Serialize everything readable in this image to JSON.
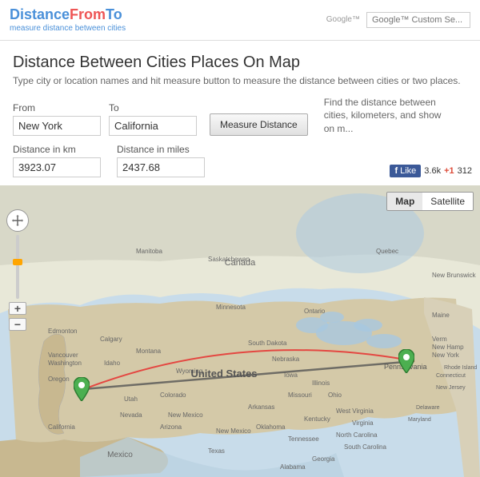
{
  "header": {
    "logo": "DistanceFromTo",
    "logo_distance": "Distance",
    "logo_from": "From",
    "logo_to": "To",
    "subtitle": "measure distance between cities",
    "search_placeholder": "Google™ Custom Se..."
  },
  "page": {
    "title": "Distance Between Cities Places On Map",
    "subtitle": "Type city or location names and hit measure button to measure the distance between cities or two places."
  },
  "form": {
    "from_label": "From",
    "from_value": "New York",
    "to_label": "To",
    "to_value": "California",
    "measure_button": "Measure Distance",
    "right_info": "Find the distance between cities, kilometers, and show on m..."
  },
  "distances": {
    "km_label": "Distance in km",
    "km_value": "3923.07",
    "miles_label": "Distance in miles",
    "miles_value": "2437.68"
  },
  "social": {
    "like_label": "Like",
    "like_count": "3.6k",
    "gplus_label": "+1",
    "gplus_count": "312"
  },
  "map": {
    "map_button": "Map",
    "satellite_button": "Satellite",
    "zoom_in": "+",
    "zoom_out": "−",
    "label_us": "United States",
    "label_canada": "Canada",
    "label_mexico": "Mexico",
    "label_pennsylvania": "Pennsylvania",
    "route_from": "New York",
    "route_to": "California"
  },
  "colors": {
    "accent": "#4a90d9",
    "logo_red": "#e55",
    "marker_green": "#4caf50",
    "route_gray": "#555",
    "route_red": "#e53935"
  }
}
